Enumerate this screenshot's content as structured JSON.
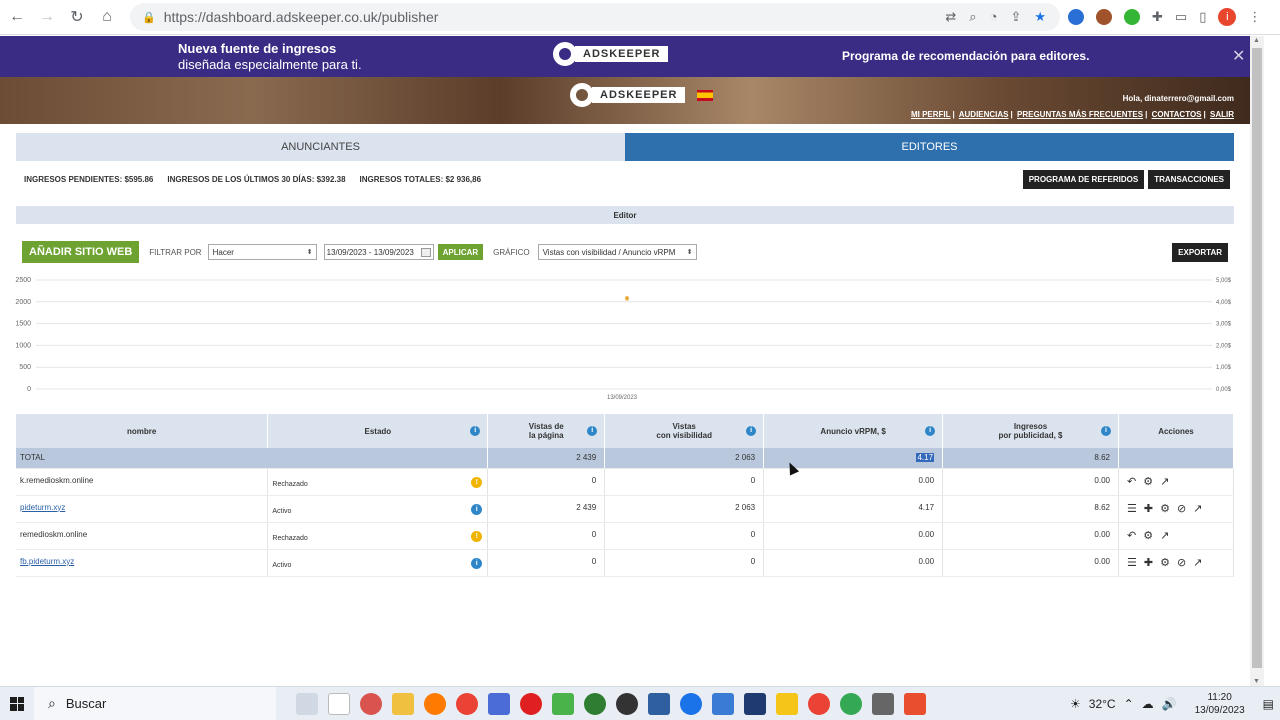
{
  "browser": {
    "url": "https://dashboard.adskeeper.co.uk/publisher",
    "profile_initial": "i"
  },
  "promo": {
    "line1": "Nueva fuente de ingresos",
    "line2": "diseñada especialmente para ti.",
    "logo_text": "ADSKEEPER",
    "right_text": "Programa de recomendación para editores.",
    "close": "✕"
  },
  "header": {
    "logo_text": "ADSKEEPER",
    "greeting": "Hola, dinaterrero@gmail.com",
    "links": [
      "MI PERFIL",
      "AUDIENCIAS",
      "PREGUNTAS MÁS FRECUENTES",
      "CONTACTOS",
      "SALIR"
    ]
  },
  "tabs": [
    {
      "label": "ANUNCIANTES",
      "active": false
    },
    {
      "label": "EDITORES",
      "active": true
    }
  ],
  "summary": {
    "pending": "INGRESOS PENDIENTES: $595.86",
    "last30": "INGRESOS DE LOS ÚLTIMOS 30 DÍAS: $392.38",
    "total": "INGRESOS TOTALES: $2 936,86",
    "referrals_btn": "PROGRAMA DE REFERIDOS",
    "transactions_btn": "TRANSACCIONES"
  },
  "editor_bar": "Editor",
  "filters": {
    "add_site_btn": "AÑADIR SITIO WEB",
    "filter_label": "FILTRAR POR",
    "filter_value": "Hacer",
    "date_range": "13/09/2023 - 13/09/2023",
    "apply_btn": "APLICAR",
    "chart_label": "GRÁFICO",
    "chart_value": "Vistas con visibilidad / Anuncio vRPM",
    "export_btn": "EXPORTAR"
  },
  "chart_data": {
    "type": "line",
    "x": [
      "13/09/2023"
    ],
    "series": [
      {
        "axis": "left",
        "values": [
          2063
        ],
        "color": "#e8a838"
      },
      {
        "axis": "right",
        "values": [
          4.17
        ],
        "color": "#e8a838"
      }
    ],
    "ylim_left": [
      0,
      2500
    ],
    "ylim_right": [
      0,
      5
    ],
    "left_ticks": [
      "2500",
      "2000",
      "1500",
      "1000",
      "500",
      "0"
    ],
    "right_ticks": [
      "5,00$",
      "4,00$",
      "3,00$",
      "2,00$",
      "1,00$",
      "0,00$"
    ],
    "xtick": "13/09/2023",
    "grid": true
  },
  "table": {
    "headers": {
      "name": "nombre",
      "state": "Estado",
      "views_1": "Vistas de",
      "views_2": "la página",
      "visible_1": "Vistas",
      "visible_2": "con visibilidad",
      "vrpm": "Anuncio vRPM, $",
      "income_1": "Ingresos",
      "income_2": "por publicidad, $",
      "actions": "Acciones"
    },
    "total": {
      "label": "TOTAL",
      "views": "2 439",
      "visible": "2 063",
      "vrpm": "4.17",
      "income": "8.62"
    },
    "rows": [
      {
        "name": "k.remedioskm.online",
        "link": false,
        "state": "Rechazado",
        "state_icon": "warn",
        "views": "0",
        "visible": "0",
        "vrpm": "0.00",
        "income": "0.00",
        "actions": [
          "undo-icon",
          "gear-icon",
          "trend-icon"
        ]
      },
      {
        "name": "pideturm.xyz",
        "link": true,
        "state": "Activo",
        "state_icon": "info",
        "views": "2 439",
        "visible": "2 063",
        "vrpm": "4.17",
        "income": "8.62",
        "actions": [
          "list-icon",
          "plus-icon",
          "gear-icon",
          "block-icon",
          "trend-icon"
        ]
      },
      {
        "name": "remedioskm.online",
        "link": false,
        "state": "Rechazado",
        "state_icon": "warn",
        "views": "0",
        "visible": "0",
        "vrpm": "0.00",
        "income": "0.00",
        "actions": [
          "undo-icon",
          "gear-icon",
          "trend-icon"
        ]
      },
      {
        "name": "fb.pideturm.xyz",
        "link": true,
        "state": "Activo",
        "state_icon": "info",
        "views": "0",
        "visible": "0",
        "vrpm": "0.00",
        "income": "0.00",
        "actions": [
          "list-icon",
          "plus-icon",
          "gear-icon",
          "block-icon",
          "trend-icon"
        ]
      }
    ]
  },
  "taskbar": {
    "search_placeholder": "Buscar",
    "temperature": "32°C",
    "time": "11:20",
    "date": "13/09/2023"
  }
}
